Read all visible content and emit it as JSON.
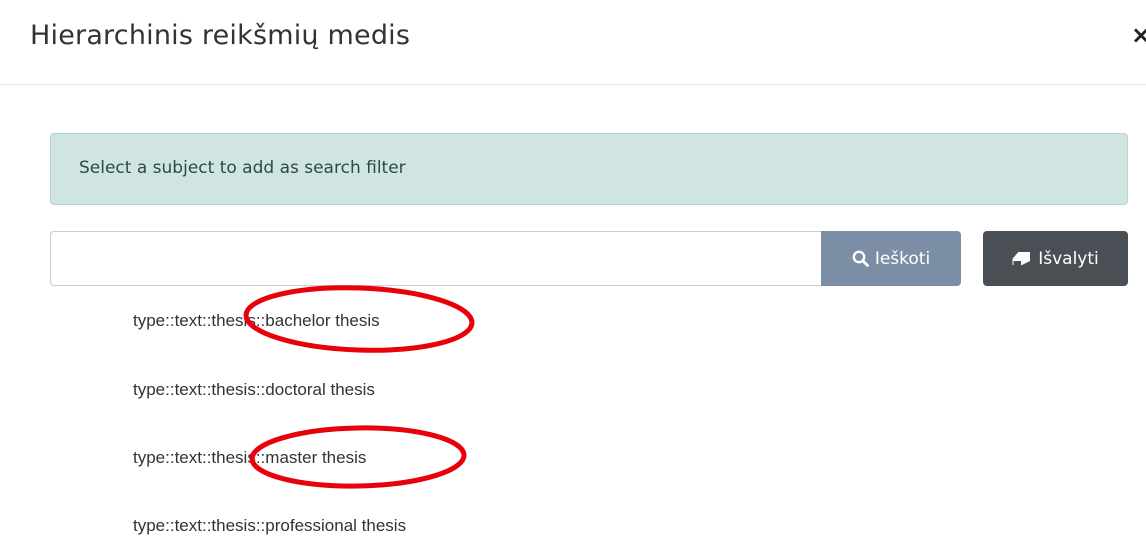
{
  "modal": {
    "title": "Hierarchinis reikšmių medis",
    "close_label": "×"
  },
  "alert": {
    "text": "Select a subject to add as search filter"
  },
  "search": {
    "value": "",
    "placeholder": "",
    "search_button_label": "Ieškoti",
    "search_button_icon": "search-icon",
    "clear_button_label": "Išvalyti",
    "clear_button_icon": "eraser-icon"
  },
  "tree": {
    "items": [
      {
        "label": "type::text::thesis::bachelor thesis"
      },
      {
        "label": "type::text::thesis::doctoral thesis"
      },
      {
        "label": "type::text::thesis::master thesis"
      },
      {
        "label": "type::text::thesis::professional thesis"
      }
    ]
  },
  "annotations": {
    "highlight_color": "#e8000b",
    "highlighted_items": [
      "type::text::thesis::bachelor thesis",
      "type::text::thesis::master thesis"
    ]
  },
  "colors": {
    "alert_background": "#d0e4e2",
    "search_button": "#7c8ea6",
    "clear_button": "#4a4f55"
  }
}
